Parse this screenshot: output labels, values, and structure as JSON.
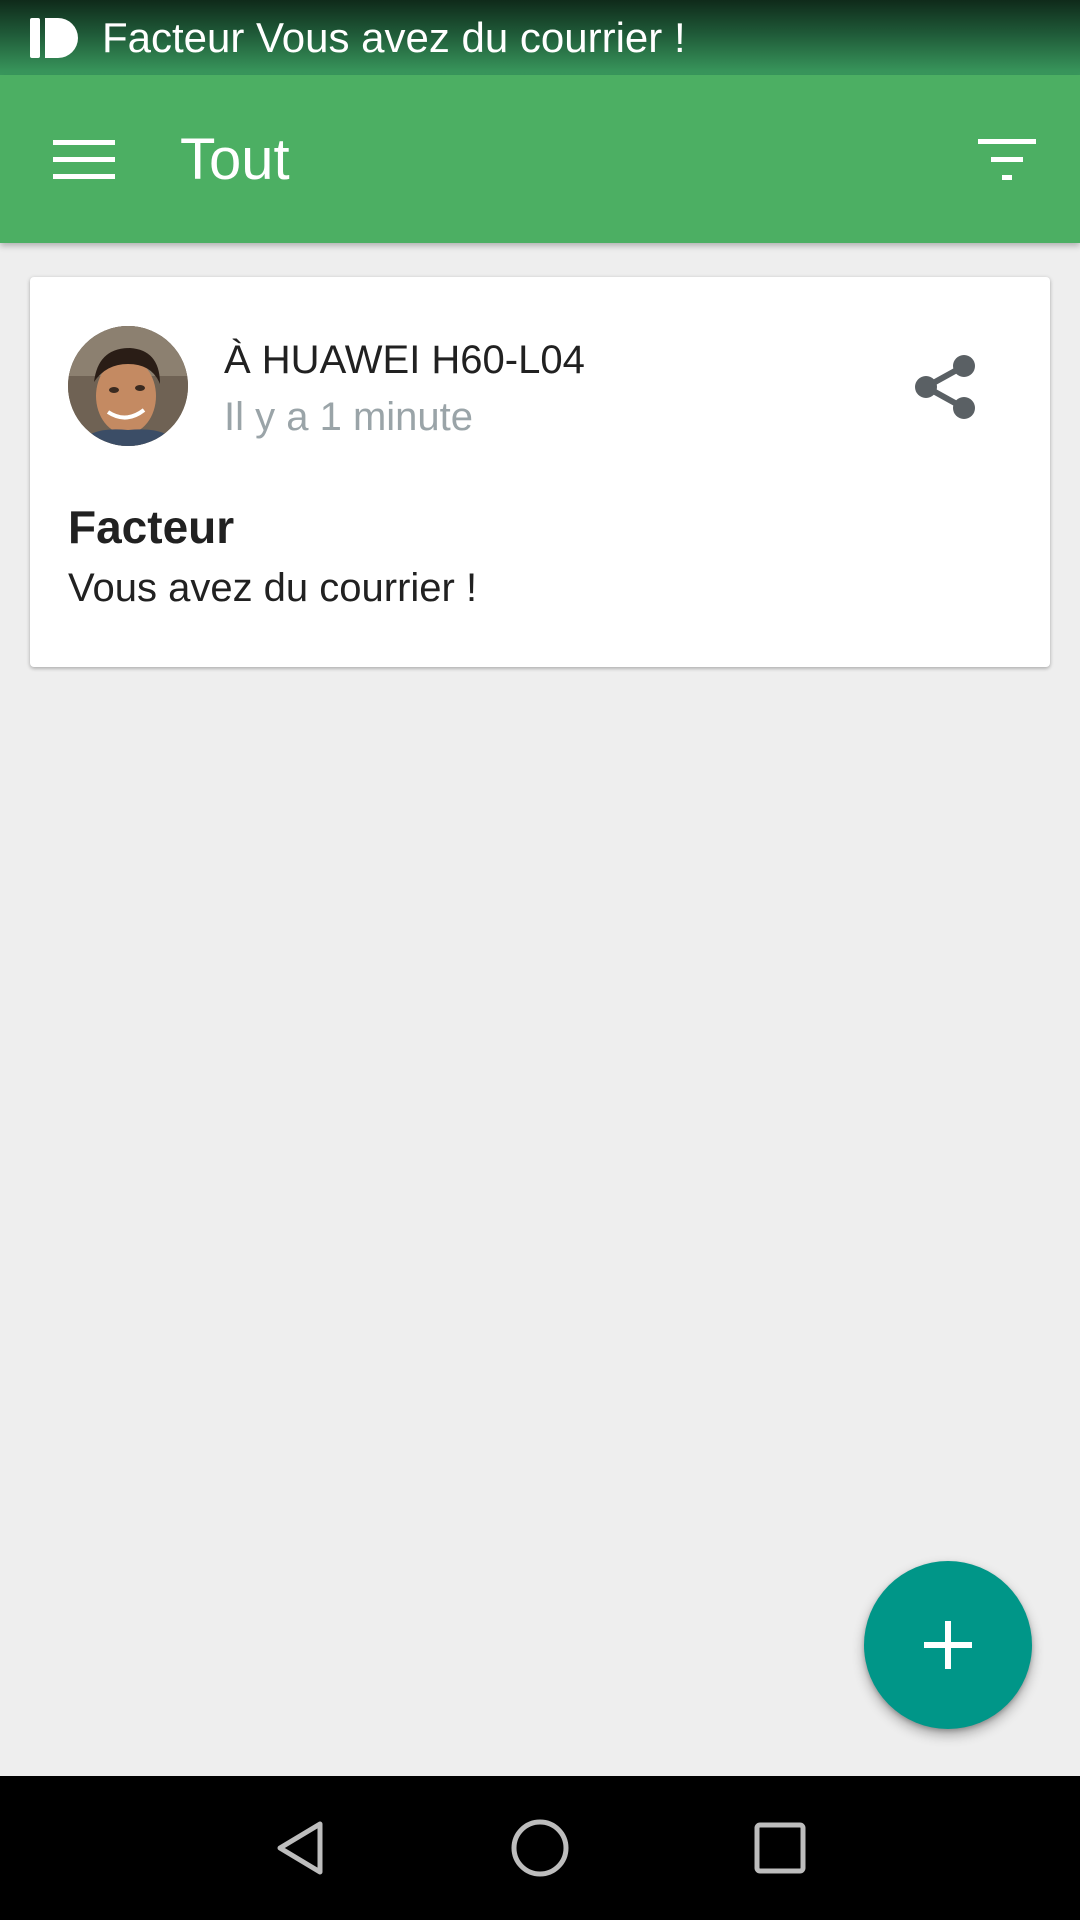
{
  "status_bar": {
    "notification_text": "Facteur Vous avez du courrier !",
    "app_icon": "pushbullet-logo-icon"
  },
  "app_bar": {
    "title": "Tout",
    "menu_icon": "hamburger-menu-icon",
    "filter_icon": "filter-list-icon"
  },
  "push_card": {
    "recipient": "À HUAWEI H60-L04",
    "timestamp": "Il y a 1 minute",
    "title": "Facteur",
    "body": "Vous avez du courrier !",
    "avatar": "user-avatar",
    "share_icon": "share-icon"
  },
  "fab": {
    "icon": "plus-icon"
  },
  "nav_bar": {
    "back_icon": "back-triangle-icon",
    "home_icon": "home-circle-icon",
    "recent_icon": "recent-apps-square-icon"
  },
  "colors": {
    "app_bar": "#4caf63",
    "fab": "#009688",
    "background": "#eeeeee",
    "timestamp_text": "#9aa4a8"
  }
}
